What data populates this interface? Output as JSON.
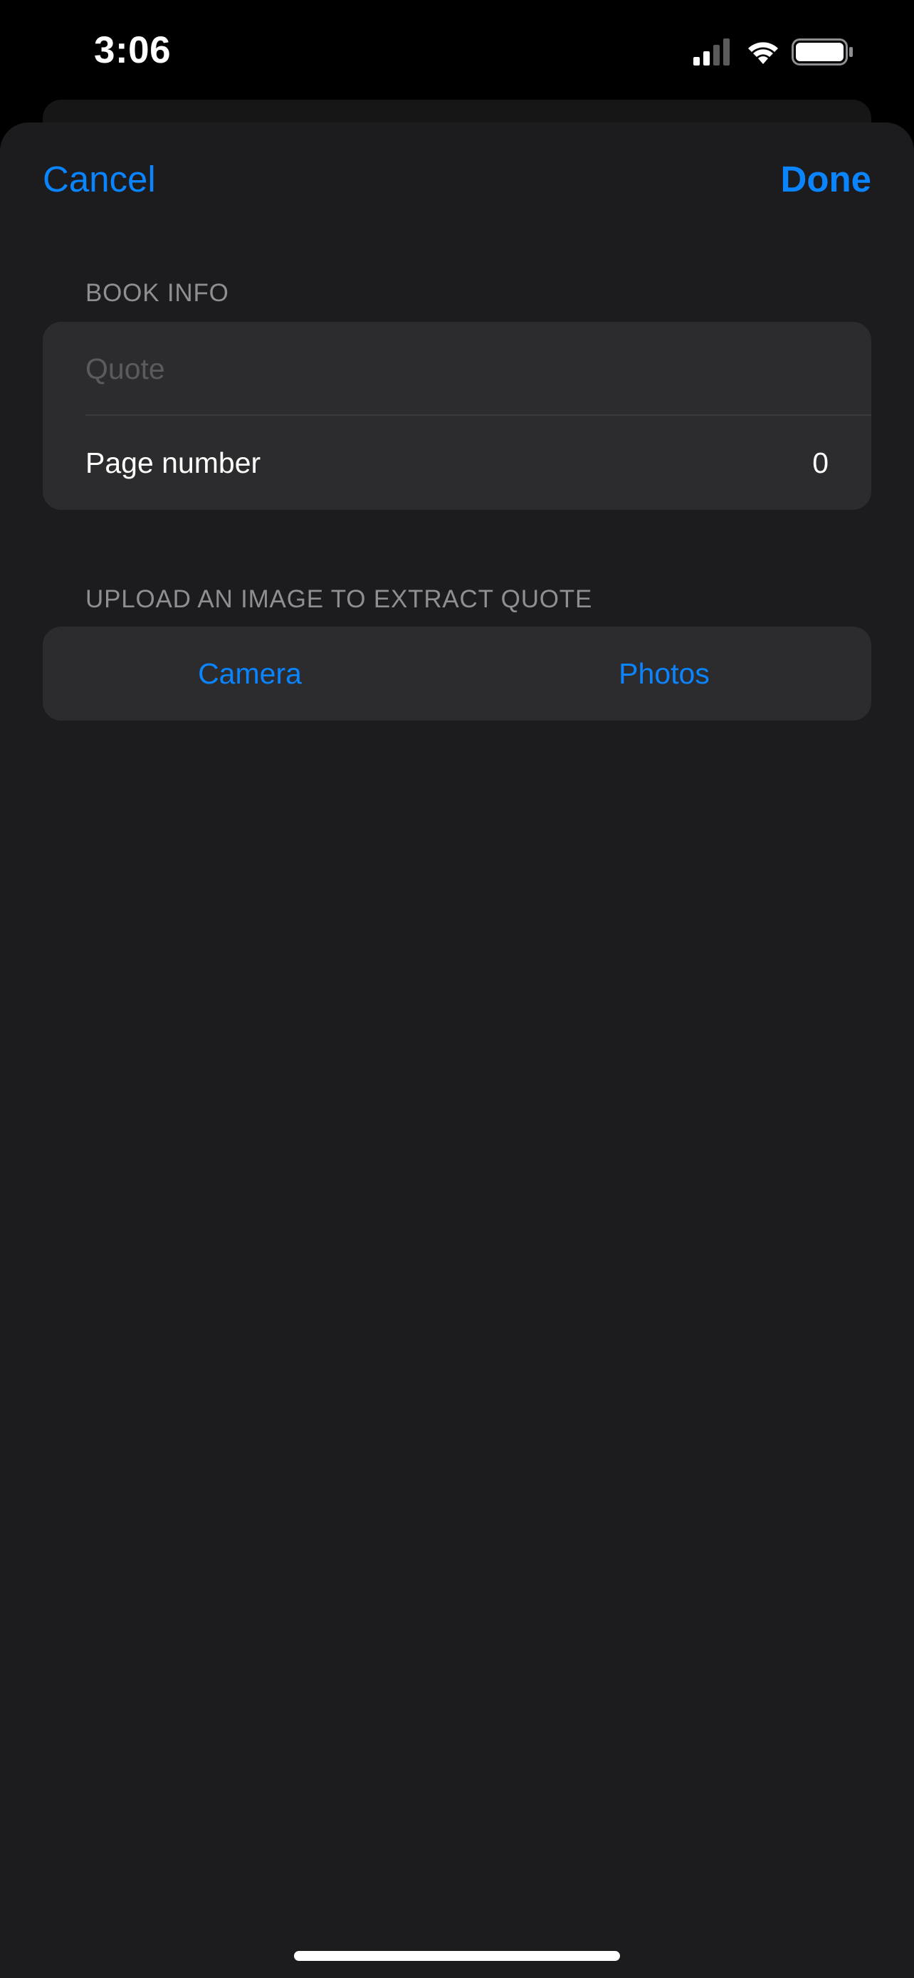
{
  "status_bar": {
    "time": "3:06",
    "signal_icon": "cellular-signal-icon",
    "wifi_icon": "wifi-icon",
    "battery_icon": "battery-full-icon"
  },
  "nav": {
    "cancel_label": "Cancel",
    "done_label": "Done"
  },
  "book_info": {
    "header": "BOOK INFO",
    "quote_placeholder": "Quote",
    "quote_value": "",
    "page_number_label": "Page number",
    "page_number_value": "0"
  },
  "upload": {
    "header": "UPLOAD AN IMAGE TO EXTRACT QUOTE",
    "camera_label": "Camera",
    "photos_label": "Photos"
  },
  "colors": {
    "accent": "#0a84ff",
    "sheet_background": "#1c1c1e",
    "group_background": "#2c2c2e",
    "secondary_text": "#8e8e93"
  }
}
